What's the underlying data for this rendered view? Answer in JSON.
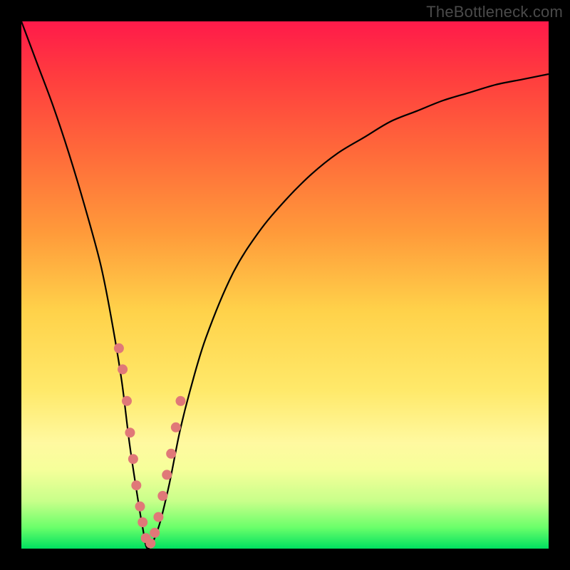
{
  "watermark": "TheBottleneck.com",
  "chart_data": {
    "type": "line",
    "title": "",
    "xlabel": "",
    "ylabel": "",
    "xlim": [
      0,
      100
    ],
    "ylim": [
      0,
      100
    ],
    "grid": false,
    "annotations": [
      "TheBottleneck.com"
    ],
    "series": [
      {
        "name": "bottleneck-curve",
        "x": [
          0,
          3,
          6,
          9,
          12,
          15,
          17,
          19,
          20.5,
          22,
          23,
          24,
          26,
          28,
          30,
          32,
          35,
          40,
          45,
          50,
          55,
          60,
          65,
          70,
          75,
          80,
          85,
          90,
          95,
          100
        ],
        "y": [
          100,
          92,
          84,
          75,
          65,
          54,
          44,
          32,
          20,
          10,
          4,
          0,
          4,
          12,
          22,
          30,
          40,
          52,
          60,
          66,
          71,
          75,
          78,
          81,
          83,
          85,
          86.5,
          88,
          89,
          90
        ]
      },
      {
        "name": "marker-dots",
        "type": "scatter",
        "x": [
          18.5,
          19.2,
          20.0,
          20.6,
          21.2,
          21.8,
          22.5,
          23.0,
          23.6,
          24.5,
          25.3,
          26.0,
          26.8,
          27.6,
          28.4,
          29.3,
          30.2
        ],
        "y": [
          38,
          34,
          28,
          22,
          17,
          12,
          8,
          5,
          2,
          1,
          3,
          6,
          10,
          14,
          18,
          23,
          28
        ]
      }
    ],
    "colors": {
      "curve": "#000000",
      "dots": "#e07878",
      "gradient_top": "#ff1a4a",
      "gradient_bottom": "#00e060"
    }
  }
}
